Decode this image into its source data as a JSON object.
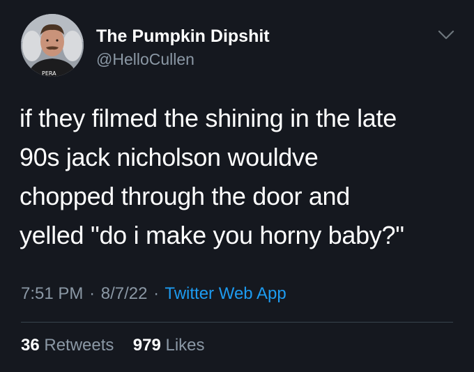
{
  "tweet": {
    "display_name": "The Pumpkin Dipshit",
    "handle": "@HelloCullen",
    "text": "if they filmed the shining in the late\n90s jack nicholson wouldve\nchopped  through the door and\nyelled \"do i make you horny baby?\"",
    "time": "7:51 PM",
    "separator": "·",
    "date": "8/7/22",
    "source": "Twitter Web App",
    "retweets_count": "36",
    "retweets_label": "Retweets",
    "likes_count": "979",
    "likes_label": "Likes"
  },
  "icons": {
    "menu": "chevron-down-icon",
    "avatar": "profile-photo"
  },
  "colors": {
    "background": "#15181f",
    "text_primary": "#ffffff",
    "text_secondary": "#8b98a5",
    "link": "#1d9bf0",
    "divider": "#38444d"
  }
}
